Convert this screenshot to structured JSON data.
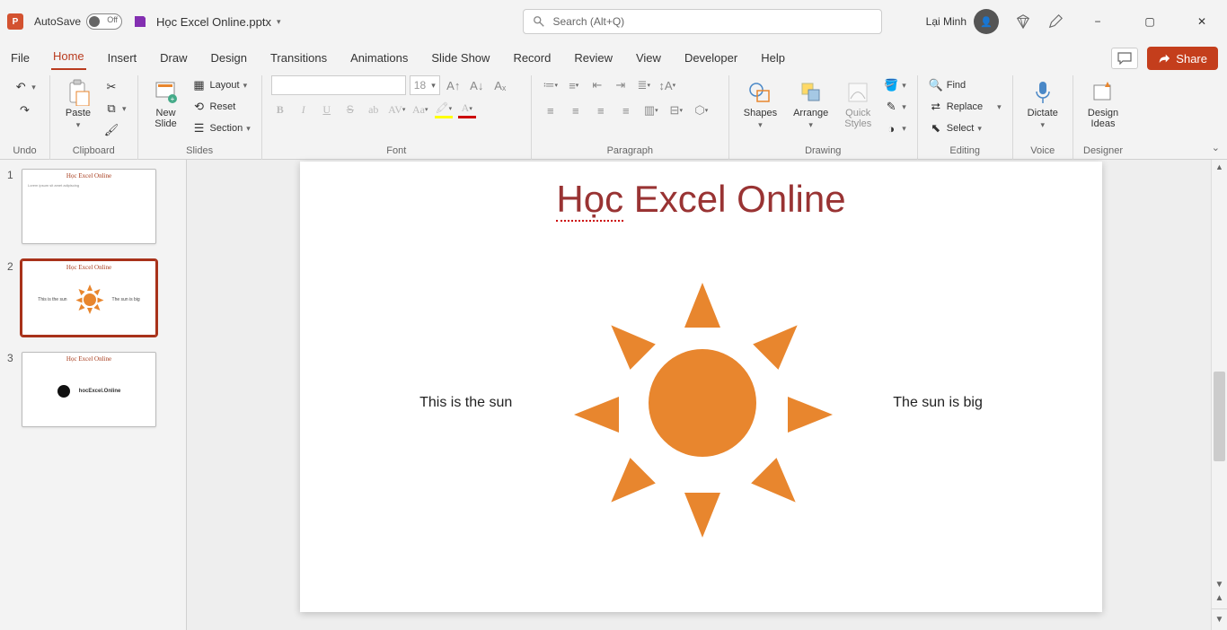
{
  "title_bar": {
    "app_letter": "P",
    "autosave_label": "AutoSave",
    "autosave_state": "Off",
    "filename": "Học Excel Online.pptx",
    "search_placeholder": "Search (Alt+Q)",
    "user_name": "Lại Minh",
    "minimize": "−",
    "restore": "▢",
    "close": "✕"
  },
  "tabs": {
    "file": "File",
    "home": "Home",
    "insert": "Insert",
    "draw": "Draw",
    "design": "Design",
    "transitions": "Transitions",
    "animations": "Animations",
    "slideshow": "Slide Show",
    "record": "Record",
    "review": "Review",
    "view": "View",
    "developer": "Developer",
    "help": "Help",
    "share": "Share"
  },
  "ribbon": {
    "groups": {
      "undo": "Undo",
      "clipboard": "Clipboard",
      "slides": "Slides",
      "font": "Font",
      "paragraph": "Paragraph",
      "drawing": "Drawing",
      "editing": "Editing",
      "voice": "Voice",
      "designer": "Designer"
    },
    "buttons": {
      "paste": "Paste",
      "new_slide": "New\nSlide",
      "layout": "Layout",
      "reset": "Reset",
      "section": "Section",
      "font_size": "18",
      "shapes": "Shapes",
      "arrange": "Arrange",
      "quick_styles": "Quick\nStyles",
      "find": "Find",
      "replace": "Replace",
      "select": "Select",
      "dictate": "Dictate",
      "design_ideas": "Design\nIdeas"
    }
  },
  "slides_panel": {
    "items": [
      {
        "num": "1",
        "title": "Học Excel Online",
        "kind": "text"
      },
      {
        "num": "2",
        "title": "Học Excel Online",
        "kind": "sun",
        "left": "This is the sun",
        "right": "The sun is big"
      },
      {
        "num": "3",
        "title": "Học Excel Online",
        "kind": "logo",
        "sub": "hocExcel.Online"
      }
    ]
  },
  "slide": {
    "title_underlined": "Học",
    "title_rest": " Excel Online",
    "left_text": "This is the sun",
    "right_text": "The sun is big"
  },
  "colors": {
    "accent": "#c43e1c",
    "sun": "#e8862e",
    "title": "#933a2a"
  }
}
